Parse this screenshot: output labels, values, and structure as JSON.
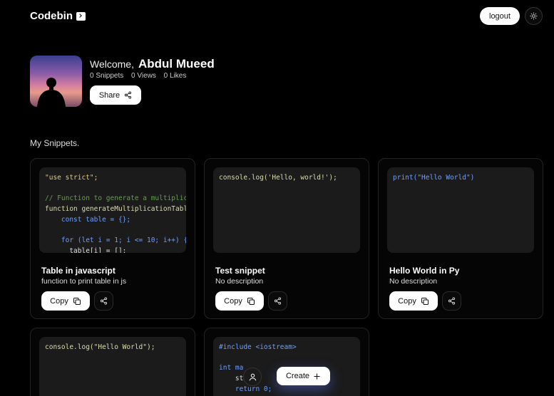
{
  "header": {
    "brand": "Codebin",
    "logout_label": "logout"
  },
  "profile": {
    "welcome": "Welcome,",
    "name": "Abdul Mueed",
    "snippets": "0 Snippets",
    "views": "0 Views",
    "likes": "0 Likes",
    "share_label": "Share"
  },
  "section_title": "My Snippets.",
  "snippets": [
    {
      "title": "Table in javascript",
      "description": "function to print table in js",
      "copy_label": "Copy",
      "code": [
        "\"use strict\";",
        "",
        "// Function to generate a multiplicat",
        "function generateMultiplicationTable(",
        "    const table = {};",
        "",
        "    for (let i = 1; i <= 10; i++) {",
        "      table[i] = [];"
      ]
    },
    {
      "title": "Test snippet",
      "description": "No description",
      "copy_label": "Copy",
      "code": [
        "console.log('Hello, world!');"
      ]
    },
    {
      "title": "Hello World in Py",
      "description": "No description",
      "copy_label": "Copy",
      "code": [
        "print(\"Hello World\")"
      ]
    },
    {
      "code": [
        "console.log(\"Hello World\");"
      ]
    },
    {
      "code": [
        "#include <iostream>",
        "",
        "int ma",
        "    st",
        "    return 0;"
      ]
    }
  ],
  "dock": {
    "create_label": "Create"
  },
  "icons": {
    "brand": "terminal-icon",
    "theme": "sun-icon",
    "share": "share-icon",
    "copy": "copy-icon",
    "user": "user-icon",
    "create": "plus-icon"
  }
}
